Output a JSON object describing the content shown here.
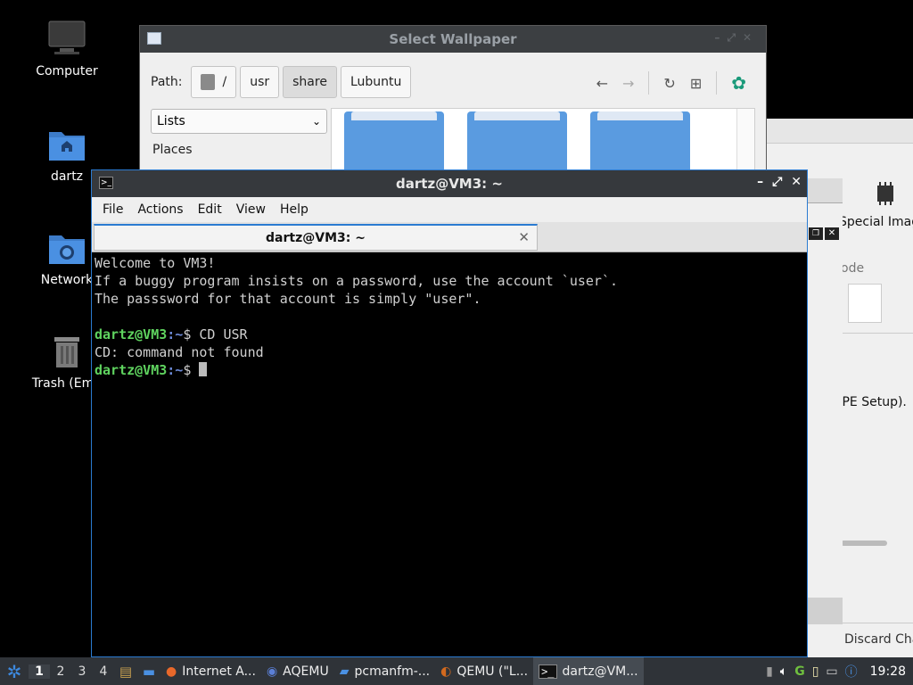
{
  "desktop": {
    "icons": [
      {
        "label": "Computer"
      },
      {
        "label": "dartz"
      },
      {
        "label": "Network"
      },
      {
        "label": "Trash (Emp"
      }
    ]
  },
  "background_window": {
    "item_label": "Special Imag",
    "mode_fragment": "ode",
    "setup_fragment": "(PE Setup).",
    "discard_button": "Discard Cha"
  },
  "wallpaper_dialog": {
    "title": "Select Wallpaper",
    "path_label": "Path:",
    "crumbs": [
      "/",
      "usr",
      "share",
      "Lubuntu"
    ],
    "view_mode": "Lists",
    "places_label": "Places"
  },
  "terminal": {
    "title": "dartz@VM3: ~",
    "menu": [
      "File",
      "Actions",
      "Edit",
      "View",
      "Help"
    ],
    "tab_label": "dartz@VM3: ~",
    "lines": {
      "l1": "Welcome to VM3!",
      "l2": "If a buggy program insists on a password, use the account `user`.",
      "l3": "The passsword for that account is simply \"user\".",
      "prompt1_user": "dartz@VM3",
      "prompt1_path": ":~",
      "prompt1_cmd": "$ CD USR",
      "l5": "CD: command not found",
      "prompt2_user": "dartz@VM3",
      "prompt2_path": ":~",
      "prompt2_cmd": "$ "
    }
  },
  "taskbar": {
    "desktops": [
      "1",
      "2",
      "3",
      "4"
    ],
    "tasks": [
      {
        "label": "Internet A...",
        "icon": "firefox-icon"
      },
      {
        "label": "AQEMU",
        "icon": "aqemu-icon"
      },
      {
        "label": "pcmanfm-...",
        "icon": "folder-icon"
      },
      {
        "label": "QEMU (\"L...",
        "icon": "qemu-icon"
      },
      {
        "label": "dartz@VM...",
        "icon": "terminal-icon"
      }
    ],
    "clock": "19:28"
  },
  "colors": {
    "accent": "#2b7bd1",
    "prompt_green": "#5fd35f",
    "folder_blue": "#5a9be0"
  }
}
